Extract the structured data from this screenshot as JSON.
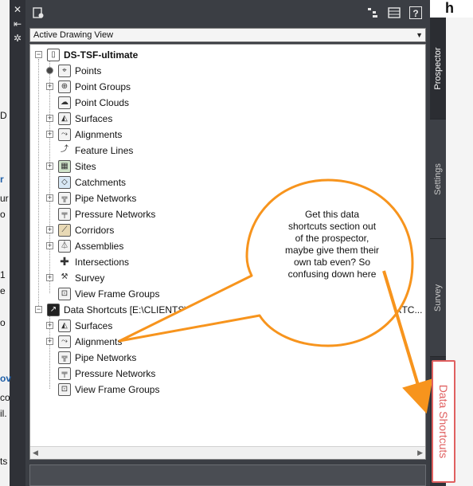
{
  "background": {
    "fragments": [
      "h",
      "D",
      "r",
      "ur",
      "o",
      "1",
      "e",
      "o",
      "ov",
      "co",
      "il.",
      "ts"
    ]
  },
  "palette": {
    "titlebar_icons": [
      "close-icon",
      "pin-icon",
      "properties-icon"
    ],
    "toolbar_icons": [
      "prospector-options-icon",
      "item-view-icon",
      "list-view-icon",
      "help-icon"
    ],
    "help_label": "?",
    "view_select": {
      "value": "Active Drawing View"
    }
  },
  "tree": {
    "drawing": {
      "label": "DS-TSF-ultimate",
      "items": [
        {
          "label": "Points",
          "icon": "points-icon"
        },
        {
          "label": "Point Groups",
          "icon": "point-groups-icon"
        },
        {
          "label": "Point Clouds",
          "icon": "point-clouds-icon"
        },
        {
          "label": "Surfaces",
          "icon": "surfaces-icon"
        },
        {
          "label": "Alignments",
          "icon": "alignments-icon"
        },
        {
          "label": "Feature Lines",
          "icon": "feature-lines-icon"
        },
        {
          "label": "Sites",
          "icon": "sites-icon"
        },
        {
          "label": "Catchments",
          "icon": "catchments-icon"
        },
        {
          "label": "Pipe Networks",
          "icon": "pipe-networks-icon"
        },
        {
          "label": "Pressure Networks",
          "icon": "pressure-networks-icon"
        },
        {
          "label": "Corridors",
          "icon": "corridors-icon"
        },
        {
          "label": "Assemblies",
          "icon": "assemblies-icon"
        },
        {
          "label": "Intersections",
          "icon": "intersections-icon"
        },
        {
          "label": "Survey",
          "icon": "survey-icon"
        },
        {
          "label": "View Frame Groups",
          "icon": "view-frame-groups-icon"
        }
      ]
    },
    "shortcuts": {
      "label": "Data Shortcuts [E:\\CLIENTS\\",
      "label_tail": "RTC...",
      "items": [
        {
          "label": "Surfaces",
          "icon": "shortcut-surfaces-icon"
        },
        {
          "label": "Alignments",
          "icon": "shortcut-alignments-icon"
        },
        {
          "label": "Pipe Networks",
          "icon": "shortcut-pipe-networks-icon"
        },
        {
          "label": "Pressure Networks",
          "icon": "shortcut-pressure-networks-icon"
        },
        {
          "label": "View Frame Groups",
          "icon": "shortcut-view-frame-groups-icon"
        }
      ]
    }
  },
  "side_tabs": [
    {
      "label": "Prospector",
      "active": true
    },
    {
      "label": "Settings",
      "active": false
    },
    {
      "label": "Survey",
      "active": false
    }
  ],
  "annotation": {
    "callout_text": "Get this data shortcuts section out of the prospector, maybe give them their own tab even? So confusing down here",
    "proposed_tab_label": "Data Shortcuts",
    "callout_color": "#f7941d",
    "proposed_tab_color": "#e06060"
  }
}
